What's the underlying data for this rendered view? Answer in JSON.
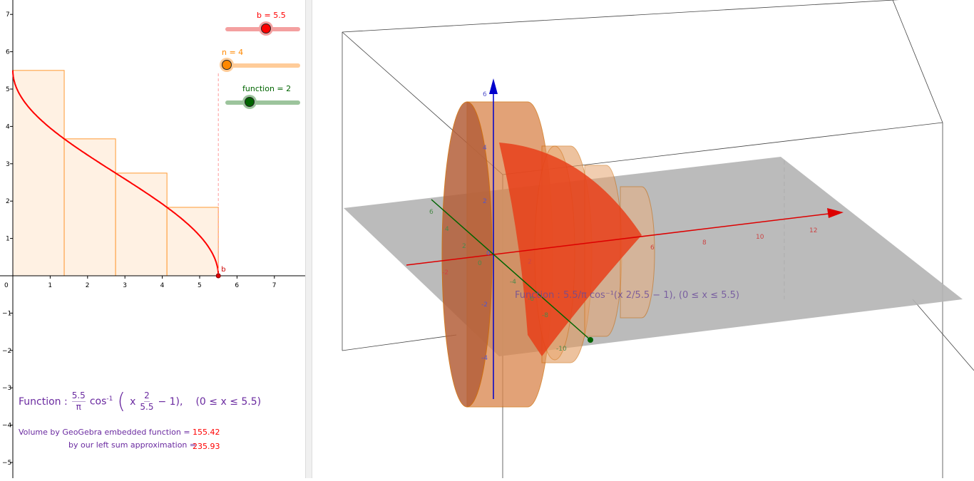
{
  "graphics2d": {
    "x_ticks": [
      "0",
      "1",
      "2",
      "3",
      "4",
      "5",
      "6",
      "7"
    ],
    "y_ticks": [
      "7",
      "6",
      "5",
      "4",
      "3",
      "2",
      "1",
      "−1",
      "−2",
      "−3",
      "−4",
      "−5"
    ],
    "point_label": "b",
    "function_color": "#ff0000",
    "rect_color": "#ff9933"
  },
  "chart_data": {
    "type": "line",
    "function": "5.5/π · acos(x·2/5.5 − 1)",
    "domain": [
      0,
      5.5
    ],
    "xlim": [
      0,
      7.8
    ],
    "ylim": [
      -5.4,
      7.4
    ],
    "left_sum_rectangles": {
      "n": 4,
      "width": 1.375,
      "heights": [
        5.5,
        3.667,
        2.75,
        1.833
      ]
    }
  },
  "sliders": [
    {
      "label": "b = 5.5",
      "value": 5.5,
      "fraction": 0.55,
      "color": "#ff0000",
      "track": "#f4a0a0"
    },
    {
      "label": "n = 4",
      "value": 4,
      "fraction": 0.03,
      "color": "#ff8800",
      "track": "#ffcc99"
    },
    {
      "label": "function = 2",
      "value": 2,
      "fraction": 0.33,
      "color": "#006400",
      "track": "#9cc49c"
    }
  ],
  "formula": {
    "prefix": "Function :",
    "num1": "5.5",
    "den1": "π",
    "cos": "cos",
    "exp": "-1",
    "x": "x",
    "num2": "2",
    "den2": "5.5",
    "minus1": "− 1),",
    "domain": "(0 ≤ x ≤ 5.5)"
  },
  "volume": {
    "embedded_label": "Volume by GeoGebra embedded function =",
    "embedded_value": "155.42",
    "leftsum_label": "by our left sum approximation =",
    "leftsum_value": "235.93"
  },
  "graphics3d": {
    "x_ticks": [
      "-2",
      "2",
      "6",
      "8",
      "10",
      "12"
    ],
    "y_ticks": [
      "6",
      "4",
      "2",
      "0",
      "-4",
      "-6",
      "-8",
      "-10"
    ],
    "z_ticks": [
      "6",
      "4",
      "2",
      "0",
      "-2",
      "-4"
    ],
    "formula_label": "Function :  5.5/π cos⁻¹(x 2/5.5 − 1),   (0 ≤ x ≤ 5.5)"
  }
}
